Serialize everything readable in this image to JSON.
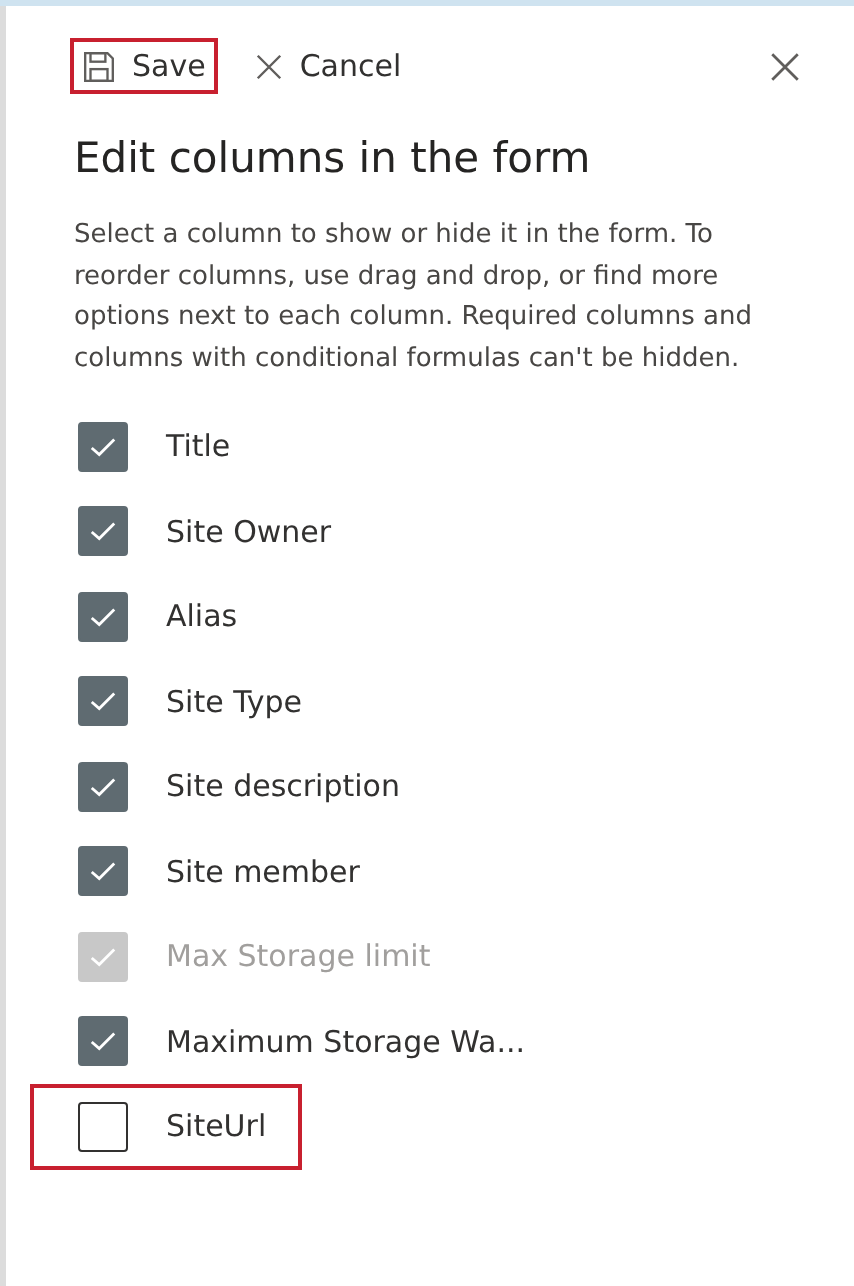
{
  "toolbar": {
    "save": {
      "label": "Save",
      "highlighted": true
    },
    "cancel": {
      "label": "Cancel"
    }
  },
  "title": "Edit columns in the form",
  "description": "Select a column to show or hide it in the form. To reorder columns, use drag and drop, or find more options next to each column. Required columns and columns with conditional formulas can't be hidden.",
  "columns": [
    {
      "label": "Title",
      "checked": true,
      "disabled": false,
      "highlighted": false
    },
    {
      "label": "Site Owner",
      "checked": true,
      "disabled": false,
      "highlighted": false
    },
    {
      "label": "Alias",
      "checked": true,
      "disabled": false,
      "highlighted": false
    },
    {
      "label": "Site Type",
      "checked": true,
      "disabled": false,
      "highlighted": false
    },
    {
      "label": "Site description",
      "checked": true,
      "disabled": false,
      "highlighted": false
    },
    {
      "label": "Site member",
      "checked": true,
      "disabled": false,
      "highlighted": false
    },
    {
      "label": "Max Storage limit",
      "checked": true,
      "disabled": true,
      "highlighted": false
    },
    {
      "label": "Maximum Storage Wa...",
      "checked": true,
      "disabled": false,
      "highlighted": false
    },
    {
      "label": "SiteUrl",
      "checked": false,
      "disabled": false,
      "highlighted": true
    }
  ]
}
